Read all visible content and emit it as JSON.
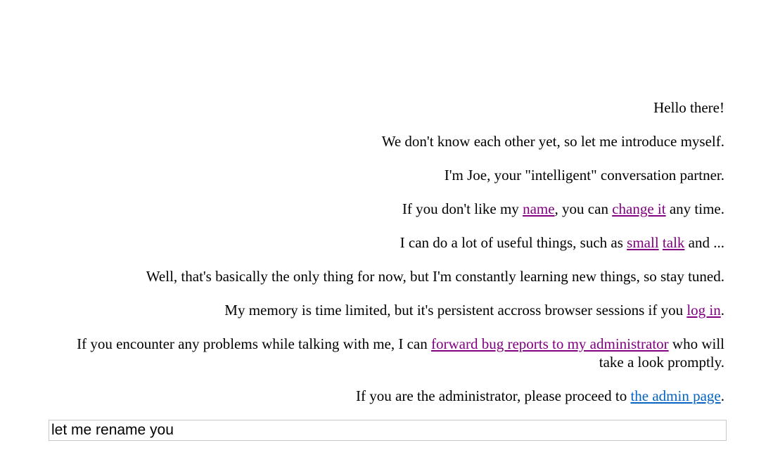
{
  "messages": {
    "m1": "Hello there!",
    "m2": "We don't know each other yet, so let me introduce myself.",
    "m3": "I'm Joe, your \"intelligent\" conversation partner.",
    "m4": {
      "t1": "If you don't like my ",
      "link_name": "name",
      "t2": ", you can ",
      "link_change": "change it",
      "t3": " any time."
    },
    "m5": {
      "t1": "I can do a lot of useful things, such as ",
      "link_small": "small",
      "t2": " ",
      "link_talk": "talk",
      "t3": " and ..."
    },
    "m6": "Well, that's basically the only thing for now, but I'm constantly learning new things, so stay tuned.",
    "m7": {
      "t1": "My memory is time limited, but it's persistent accross browser sessions if you ",
      "link_login": "log in",
      "t2": "."
    },
    "m8": {
      "t1": "If you encounter any problems while talking with me, I can ",
      "link_bug": "forward bug reports to my administrator",
      "t2": " who will take a look promptly."
    },
    "m9": {
      "t1": "If you are the administrator, please proceed to ",
      "link_admin": "the admin page",
      "t2": "."
    }
  },
  "input": {
    "value": "let me rename you"
  },
  "colors": {
    "visited_link": "#800080",
    "link": "#0563c1"
  }
}
